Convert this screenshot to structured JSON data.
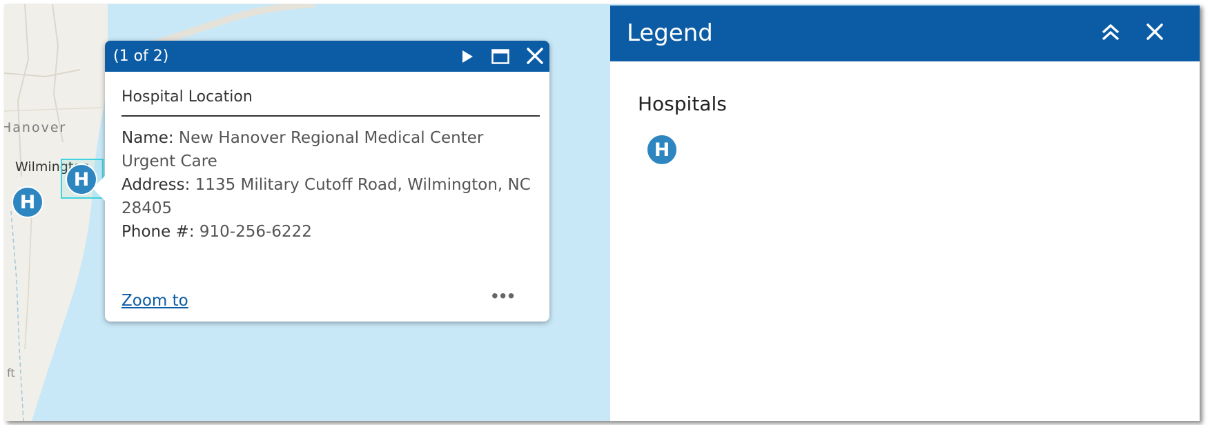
{
  "map": {
    "labels": {
      "county": "Hanover",
      "city": "Wilmington",
      "elevation_unit": "ft"
    },
    "markers": [
      {
        "letter": "H"
      },
      {
        "letter": "H"
      }
    ]
  },
  "popup": {
    "count": "(1 of 2)",
    "title": "Hospital Location",
    "fields": {
      "name_label": "Name:",
      "name_value": "New Hanover Regional Medical Center Urgent Care",
      "address_label": "Address:",
      "address_value": "1135 Military Cutoff Road, Wilmington, NC 28405",
      "phone_label": "Phone #:",
      "phone_value": "910-256-6222"
    },
    "zoom_link": "Zoom to",
    "more": "•••",
    "icons": [
      "play-next-icon",
      "maximize-icon",
      "close-icon"
    ]
  },
  "legend": {
    "title": "Legend",
    "layer_name": "Hospitals",
    "symbol_letter": "H",
    "icons": [
      "double-chevron-up-icon",
      "close-icon"
    ]
  },
  "colors": {
    "header_blue": "#0c5ca5",
    "marker_blue": "#2e86c1",
    "water": "#c9e8f7",
    "selection": "#3fd3e0"
  }
}
